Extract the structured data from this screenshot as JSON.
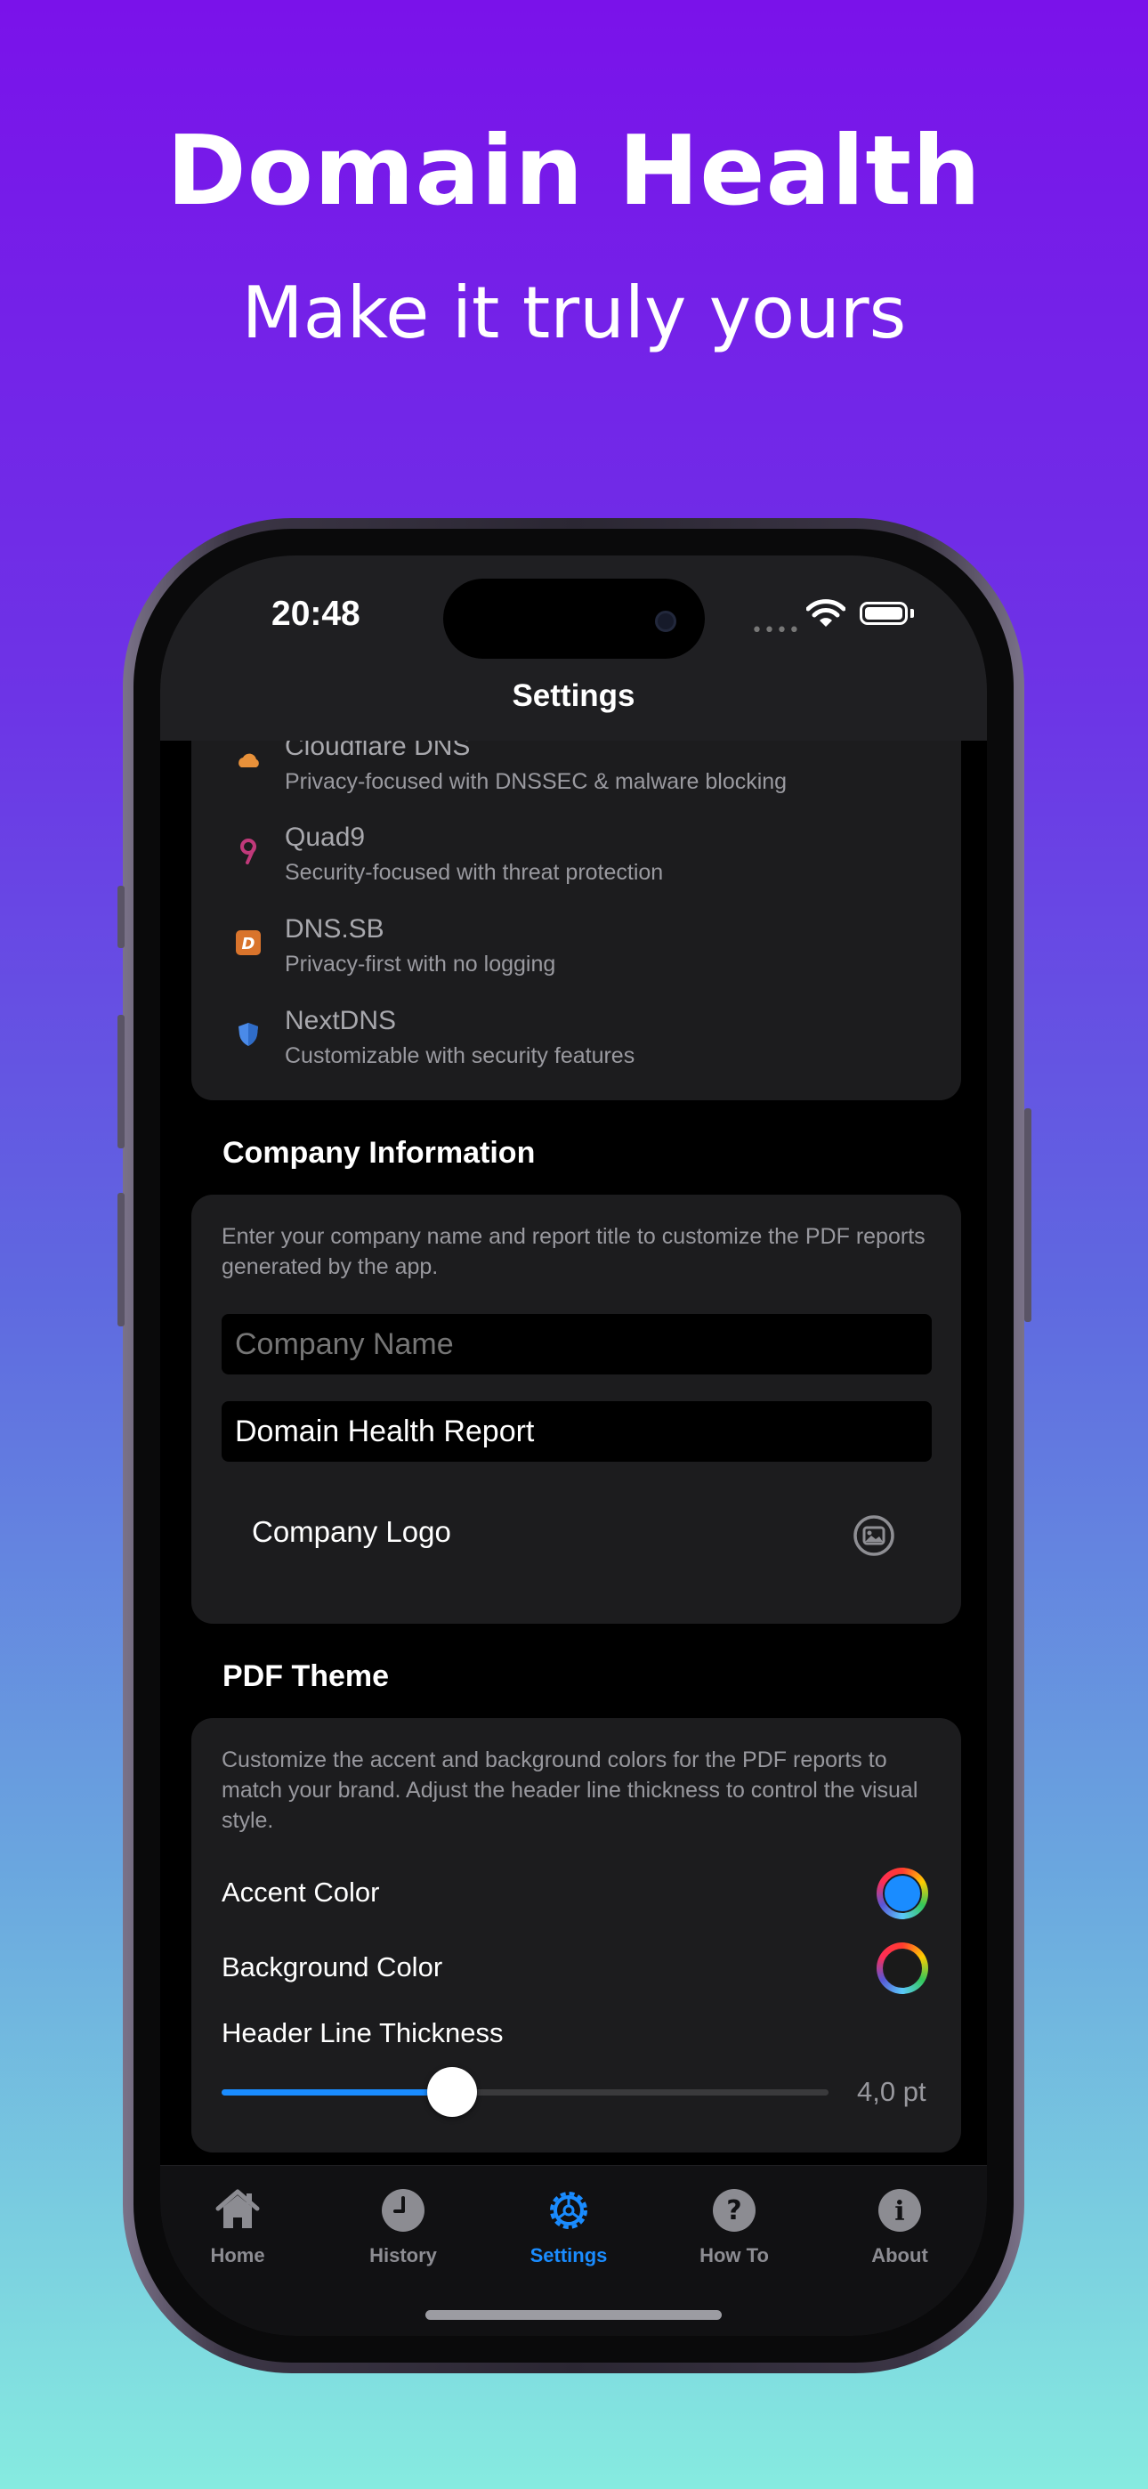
{
  "promo": {
    "title": "Domain Health",
    "subtitle": "Make it truly yours"
  },
  "status_bar": {
    "time": "20:48",
    "signal": "••••"
  },
  "nav": {
    "title": "Settings"
  },
  "dns_providers": [
    {
      "name": "Cloudflare DNS",
      "description": "Privacy-focused with DNSSEC & malware blocking",
      "icon": "cloud-icon"
    },
    {
      "name": "Quad9",
      "description": "Security-focused with threat protection",
      "icon": "quad9-icon"
    },
    {
      "name": "DNS.SB",
      "description": "Privacy-first with no logging",
      "icon": "dnssb-icon"
    },
    {
      "name": "NextDNS",
      "description": "Customizable with security features",
      "icon": "shield-icon"
    }
  ],
  "company": {
    "header": "Company Information",
    "description": "Enter your company name and report title to customize the PDF reports generated by the app.",
    "name_placeholder": "Company Name",
    "name_value": "",
    "report_title_value": "Domain Health Report",
    "logo_label": "Company Logo"
  },
  "pdf_theme": {
    "header": "PDF Theme",
    "description": "Customize the accent and background colors for the PDF reports to match your brand. Adjust the header line thickness to control the visual style.",
    "accent_label": "Accent Color",
    "accent_color": "#1a8cff",
    "background_label": "Background Color",
    "background_color": "#1a1a1a",
    "thickness_label": "Header Line Thickness",
    "thickness_value": "4,0 pt",
    "thickness_fraction": 0.38
  },
  "tabs": [
    {
      "label": "Home",
      "icon": "house-icon",
      "active": false
    },
    {
      "label": "History",
      "icon": "clock-icon",
      "active": false
    },
    {
      "label": "Settings",
      "icon": "gear-icon",
      "active": true
    },
    {
      "label": "How To",
      "icon": "question-icon",
      "active": false
    },
    {
      "label": "About",
      "icon": "info-icon",
      "active": false
    }
  ],
  "colors": {
    "accent": "#1a8cff",
    "card": "#1c1c1e",
    "inactive_tab": "#8c8c92"
  }
}
